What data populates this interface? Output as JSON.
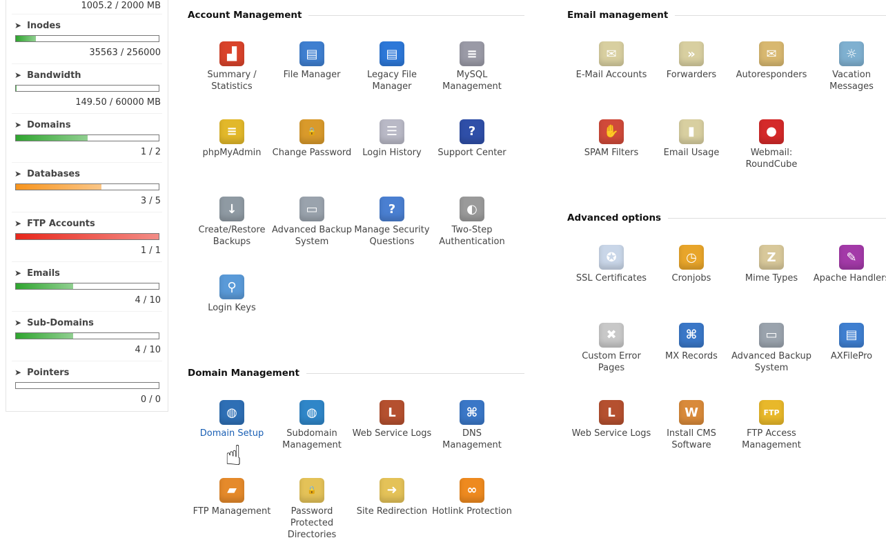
{
  "sidebar": {
    "top_value": "1005.2 / 2000 MB",
    "stats": [
      {
        "label": "Inodes",
        "value": "35563 / 256000",
        "fill": 0.14,
        "color": "#2fa52f"
      },
      {
        "label": "Bandwidth",
        "value": "149.50 / 60000 MB",
        "fill": 0.0025,
        "color": "#2fa52f"
      },
      {
        "label": "Domains",
        "value": "1 / 2",
        "fill": 0.5,
        "color": "#2fa52f"
      },
      {
        "label": "Databases",
        "value": "3 / 5",
        "fill": 0.6,
        "color": "#f7941d"
      },
      {
        "label": "FTP Accounts",
        "value": "1 / 1",
        "fill": 1.0,
        "color": "#e8281c"
      },
      {
        "label": "Emails",
        "value": "4 / 10",
        "fill": 0.4,
        "color": "#2fa52f"
      },
      {
        "label": "Sub-Domains",
        "value": "4 / 10",
        "fill": 0.4,
        "color": "#2fa52f"
      },
      {
        "label": "Pointers",
        "value": "0 / 0",
        "fill": 0,
        "color": "#2fa52f"
      }
    ]
  },
  "sections": {
    "account": {
      "title": "Account Management",
      "items": [
        {
          "label": "Summary / Statistics",
          "icon": "statistics-icon",
          "color": "#d9432b",
          "glyph": "▟"
        },
        {
          "label": "File Manager",
          "icon": "file-manager-icon",
          "color": "#3f7fd0",
          "glyph": "▤"
        },
        {
          "label": "Legacy File Manager",
          "icon": "legacy-file-manager-icon",
          "color": "#2d78d8",
          "glyph": "▤"
        },
        {
          "label": "MySQL Management",
          "icon": "database-icon",
          "color": "#9a9aa6",
          "glyph": "≡"
        },
        {
          "label": "phpMyAdmin",
          "icon": "phpmyadmin-icon",
          "color": "#e2b82a",
          "glyph": "≡"
        },
        {
          "label": "Change Password",
          "icon": "padlock-icon",
          "color": "#d99a2b",
          "glyph": "🔒"
        },
        {
          "label": "Login History",
          "icon": "login-history-icon",
          "color": "#b9b9c6",
          "glyph": "☰"
        },
        {
          "label": "Support Center",
          "icon": "support-icon",
          "color": "#2f4fa8",
          "glyph": "?"
        },
        {
          "label": "Create/Restore Backups",
          "icon": "backup-restore-icon",
          "color": "#8f9aa3",
          "glyph": "↓"
        },
        {
          "label": "Advanced Backup System",
          "icon": "backup-drive-icon",
          "color": "#9aa3ad",
          "glyph": "▭"
        },
        {
          "label": "Manage Security Questions",
          "icon": "security-question-icon",
          "color": "#4a7fd1",
          "glyph": "?"
        },
        {
          "label": "Two-Step Authentication",
          "icon": "two-step-icon",
          "color": "#9a9a9a",
          "glyph": "◐"
        },
        {
          "label": "Login Keys",
          "icon": "login-key-icon",
          "color": "#5a9ad8",
          "glyph": "⚲"
        }
      ]
    },
    "domain": {
      "title": "Domain Management",
      "items": [
        {
          "label": "Domain Setup",
          "icon": "globe-gear-icon",
          "color": "#2e6fb5",
          "glyph": "◍",
          "active": true
        },
        {
          "label": "Subdomain Management",
          "icon": "globe-icon",
          "color": "#2f86c8",
          "glyph": "◍"
        },
        {
          "label": "Web Service Logs",
          "icon": "log-icon",
          "color": "#b5502f",
          "glyph": "L"
        },
        {
          "label": "DNS Management",
          "icon": "dns-icon",
          "color": "#3a77c7",
          "glyph": "⌘"
        },
        {
          "label": "FTP Management",
          "icon": "ftp-folder-icon",
          "color": "#e58a2b",
          "glyph": "▰"
        },
        {
          "label": "Password Protected Directories",
          "icon": "locked-folder-icon",
          "color": "#e4c258",
          "glyph": "🔒"
        },
        {
          "label": "Site Redirection",
          "icon": "redirect-folder-icon",
          "color": "#e4c258",
          "glyph": "➜"
        },
        {
          "label": "Hotlink Protection",
          "icon": "hotlink-lock-icon",
          "color": "#ee8a1f",
          "glyph": "∞"
        }
      ]
    },
    "email": {
      "title": "Email management",
      "items": [
        {
          "label": "E-Mail Accounts",
          "icon": "envelope-icon",
          "color": "#d8cfa0",
          "glyph": "✉"
        },
        {
          "label": "Forwarders",
          "icon": "forward-envelope-icon",
          "color": "#d8cfa0",
          "glyph": "»"
        },
        {
          "label": "Autoresponders",
          "icon": "autoresponder-icon",
          "color": "#d8b870",
          "glyph": "✉"
        },
        {
          "label": "Vacation Messages",
          "icon": "vacation-icon",
          "color": "#7fb0d0",
          "glyph": "☼"
        },
        {
          "label": "SPAM Filters",
          "icon": "spam-filter-icon",
          "color": "#d04a3a",
          "glyph": "✋"
        },
        {
          "label": "Email Usage",
          "icon": "email-usage-icon",
          "color": "#d8cfa0",
          "glyph": "▮"
        },
        {
          "label": "Webmail: RoundCube",
          "icon": "roundcube-icon",
          "color": "#d42a2a",
          "glyph": "●"
        }
      ]
    },
    "advanced": {
      "title": "Advanced options",
      "items": [
        {
          "label": "SSL Certificates",
          "icon": "certificate-icon",
          "color": "#c9d6e8",
          "glyph": "✪"
        },
        {
          "label": "Cronjobs",
          "icon": "clock-icon",
          "color": "#e8a52a",
          "glyph": "◷"
        },
        {
          "label": "Mime Types",
          "icon": "zip-icon",
          "color": "#d8c89a",
          "glyph": "Z"
        },
        {
          "label": "Apache Handlers",
          "icon": "quill-icon",
          "color": "#a33aa8",
          "glyph": "✎"
        },
        {
          "label": "Custom Error Pages",
          "icon": "error-page-icon",
          "color": "#c8c8c8",
          "glyph": "✖"
        },
        {
          "label": "MX Records",
          "icon": "network-icon",
          "color": "#3a77c7",
          "glyph": "⌘"
        },
        {
          "label": "Advanced Backup System",
          "icon": "backup-drive-icon",
          "color": "#9aa3ad",
          "glyph": "▭"
        },
        {
          "label": "AXFilePro",
          "icon": "file-manager-icon",
          "color": "#3f7fd0",
          "glyph": "▤"
        },
        {
          "label": "Web Service Logs",
          "icon": "log-icon",
          "color": "#b5502f",
          "glyph": "L"
        },
        {
          "label": "Install CMS Software",
          "icon": "cms-box-icon",
          "color": "#d98a3a",
          "glyph": "W"
        },
        {
          "label": "FTP Access Management",
          "icon": "ftp-access-icon",
          "color": "#e8b82a",
          "glyph": "FTP"
        }
      ]
    }
  }
}
